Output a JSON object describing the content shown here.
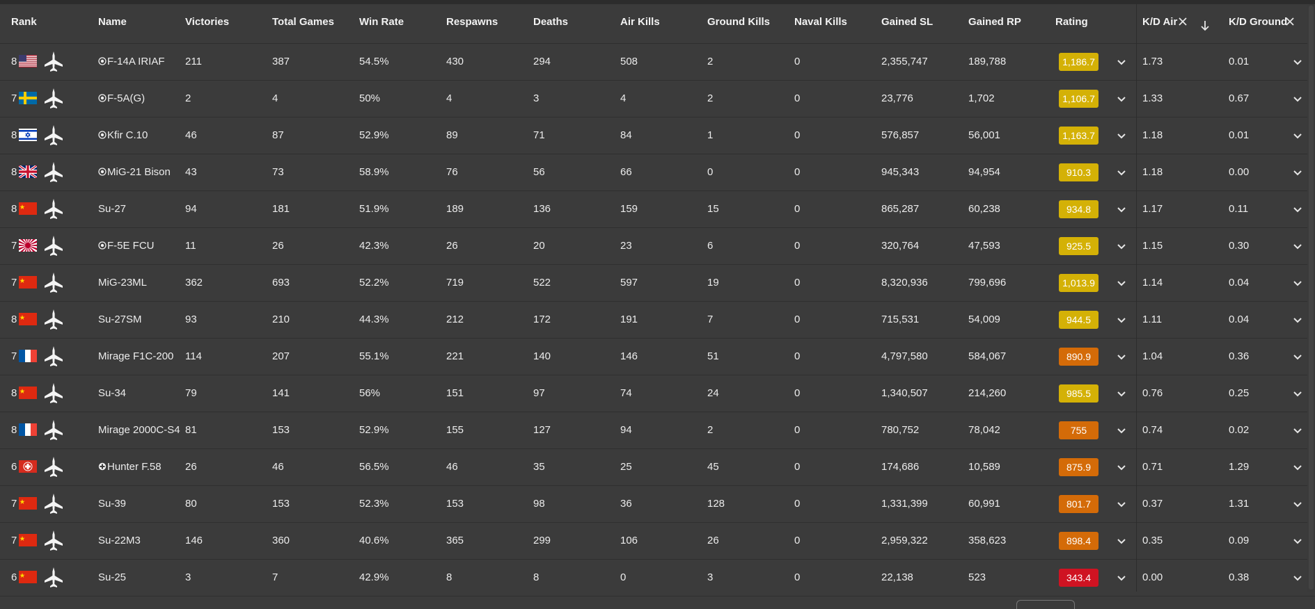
{
  "headers": [
    "Rank",
    "Name",
    "Victories",
    "Total Games",
    "Win Rate",
    "Respawns",
    "Deaths",
    "Air Kills",
    "Ground Kills",
    "Naval Kills",
    "Gained SL",
    "Gained RP",
    "Rating",
    "K/D Air",
    "K/D Ground"
  ],
  "colors": {
    "yellow": "#d4b106",
    "orange": "#d46b08",
    "red": "#cf1322",
    "background": "#3b3b3b"
  },
  "rows": [
    {
      "rank": "8",
      "flag": "us",
      "name": "F-14A IRIAF",
      "prefix": "target-icon",
      "victories": "211",
      "total": "387",
      "winrate": "54.5%",
      "respawns": "430",
      "deaths": "294",
      "air": "508",
      "ground": "2",
      "naval": "0",
      "sl": "2,355,747",
      "rp": "189,788",
      "rating": "1,186.7",
      "rating_color": "yellow",
      "kd_air": "1.73",
      "kd_ground": "0.01"
    },
    {
      "rank": "7",
      "flag": "se",
      "name": "F-5A(G)",
      "prefix": "target-icon",
      "victories": "2",
      "total": "4",
      "winrate": "50%",
      "respawns": "4",
      "deaths": "3",
      "air": "4",
      "ground": "2",
      "naval": "0",
      "sl": "23,776",
      "rp": "1,702",
      "rating": "1,106.7",
      "rating_color": "yellow",
      "kd_air": "1.33",
      "kd_ground": "0.67"
    },
    {
      "rank": "8",
      "flag": "il",
      "name": "Kfir C.10",
      "prefix": "target-icon",
      "victories": "46",
      "total": "87",
      "winrate": "52.9%",
      "respawns": "89",
      "deaths": "71",
      "air": "84",
      "ground": "1",
      "naval": "0",
      "sl": "576,857",
      "rp": "56,001",
      "rating": "1,163.7",
      "rating_color": "yellow",
      "kd_air": "1.18",
      "kd_ground": "0.01"
    },
    {
      "rank": "8",
      "flag": "uk",
      "name": "MiG-21 Bison",
      "prefix": "target-icon",
      "victories": "43",
      "total": "73",
      "winrate": "58.9%",
      "respawns": "76",
      "deaths": "56",
      "air": "66",
      "ground": "0",
      "naval": "0",
      "sl": "945,343",
      "rp": "94,954",
      "rating": "910.3",
      "rating_color": "yellow",
      "kd_air": "1.18",
      "kd_ground": "0.00"
    },
    {
      "rank": "8",
      "flag": "cn",
      "name": "Su-27",
      "prefix": "",
      "victories": "94",
      "total": "181",
      "winrate": "51.9%",
      "respawns": "189",
      "deaths": "136",
      "air": "159",
      "ground": "15",
      "naval": "0",
      "sl": "865,287",
      "rp": "60,238",
      "rating": "934.8",
      "rating_color": "yellow",
      "kd_air": "1.17",
      "kd_ground": "0.11"
    },
    {
      "rank": "7",
      "flag": "jp",
      "name": "F-5E FCU",
      "prefix": "target-icon",
      "victories": "11",
      "total": "26",
      "winrate": "42.3%",
      "respawns": "26",
      "deaths": "20",
      "air": "23",
      "ground": "6",
      "naval": "0",
      "sl": "320,764",
      "rp": "47,593",
      "rating": "925.5",
      "rating_color": "yellow",
      "kd_air": "1.15",
      "kd_ground": "0.30"
    },
    {
      "rank": "7",
      "flag": "cn",
      "name": "MiG-23ML",
      "prefix": "",
      "victories": "362",
      "total": "693",
      "winrate": "52.2%",
      "respawns": "719",
      "deaths": "522",
      "air": "597",
      "ground": "19",
      "naval": "0",
      "sl": "8,320,936",
      "rp": "799,696",
      "rating": "1,013.9",
      "rating_color": "yellow",
      "kd_air": "1.14",
      "kd_ground": "0.04"
    },
    {
      "rank": "8",
      "flag": "cn",
      "name": "Su-27SM",
      "prefix": "",
      "victories": "93",
      "total": "210",
      "winrate": "44.3%",
      "respawns": "212",
      "deaths": "172",
      "air": "191",
      "ground": "7",
      "naval": "0",
      "sl": "715,531",
      "rp": "54,009",
      "rating": "944.5",
      "rating_color": "yellow",
      "kd_air": "1.11",
      "kd_ground": "0.04"
    },
    {
      "rank": "7",
      "flag": "fr",
      "name": "Mirage F1C-200",
      "prefix": "",
      "victories": "114",
      "total": "207",
      "winrate": "55.1%",
      "respawns": "221",
      "deaths": "140",
      "air": "146",
      "ground": "51",
      "naval": "0",
      "sl": "4,797,580",
      "rp": "584,067",
      "rating": "890.9",
      "rating_color": "orange",
      "kd_air": "1.04",
      "kd_ground": "0.36"
    },
    {
      "rank": "8",
      "flag": "cn",
      "name": "Su-34",
      "prefix": "",
      "victories": "79",
      "total": "141",
      "winrate": "56%",
      "respawns": "151",
      "deaths": "97",
      "air": "74",
      "ground": "24",
      "naval": "0",
      "sl": "1,340,507",
      "rp": "214,260",
      "rating": "985.5",
      "rating_color": "yellow",
      "kd_air": "0.76",
      "kd_ground": "0.25"
    },
    {
      "rank": "8",
      "flag": "fr",
      "name": "Mirage 2000C-S4",
      "prefix": "",
      "victories": "81",
      "total": "153",
      "winrate": "52.9%",
      "respawns": "155",
      "deaths": "127",
      "air": "94",
      "ground": "2",
      "naval": "0",
      "sl": "780,752",
      "rp": "78,042",
      "rating": "755",
      "rating_color": "orange",
      "kd_air": "0.74",
      "kd_ground": "0.02"
    },
    {
      "rank": "6",
      "flag": "ch",
      "name": "Hunter F.58",
      "prefix": "cross-icon",
      "victories": "26",
      "total": "46",
      "winrate": "56.5%",
      "respawns": "46",
      "deaths": "35",
      "air": "25",
      "ground": "45",
      "naval": "0",
      "sl": "174,686",
      "rp": "10,589",
      "rating": "875.9",
      "rating_color": "orange",
      "kd_air": "0.71",
      "kd_ground": "1.29"
    },
    {
      "rank": "7",
      "flag": "cn",
      "name": "Su-39",
      "prefix": "",
      "victories": "80",
      "total": "153",
      "winrate": "52.3%",
      "respawns": "153",
      "deaths": "98",
      "air": "36",
      "ground": "128",
      "naval": "0",
      "sl": "1,331,399",
      "rp": "60,991",
      "rating": "801.7",
      "rating_color": "orange",
      "kd_air": "0.37",
      "kd_ground": "1.31"
    },
    {
      "rank": "7",
      "flag": "cn",
      "name": "Su-22M3",
      "prefix": "",
      "victories": "146",
      "total": "360",
      "winrate": "40.6%",
      "respawns": "365",
      "deaths": "299",
      "air": "106",
      "ground": "26",
      "naval": "0",
      "sl": "2,959,322",
      "rp": "358,623",
      "rating": "898.4",
      "rating_color": "orange",
      "kd_air": "0.35",
      "kd_ground": "0.09"
    },
    {
      "rank": "6",
      "flag": "cn",
      "name": "Su-25",
      "prefix": "",
      "victories": "3",
      "total": "7",
      "winrate": "42.9%",
      "respawns": "8",
      "deaths": "8",
      "air": "0",
      "ground": "3",
      "naval": "0",
      "sl": "22,138",
      "rp": "523",
      "rating": "343.4",
      "rating_color": "red",
      "kd_air": "0.00",
      "kd_ground": "0.38"
    }
  ]
}
